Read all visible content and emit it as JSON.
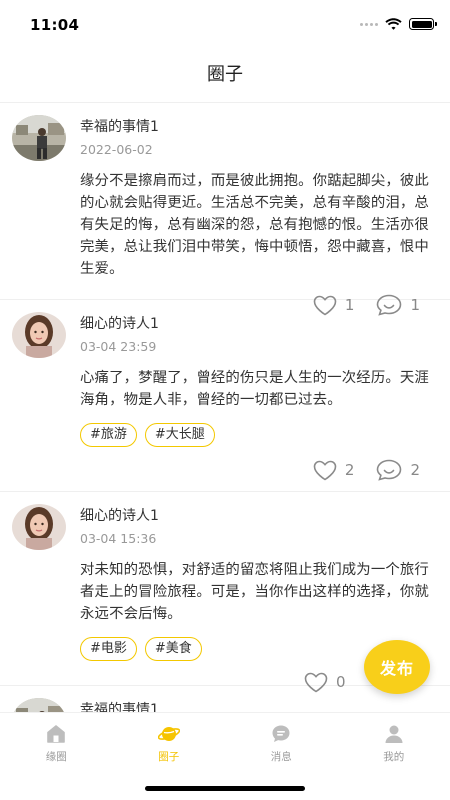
{
  "status_bar": {
    "time": "11:04"
  },
  "nav": {
    "title": "圈子"
  },
  "posts": [
    {
      "name": "幸福的事情1",
      "date": "2022-06-02",
      "text": "缘分不是擦肩而过，而是彼此拥抱。你踮起脚尖，彼此的心就会贴得更近。生活总不完美，总有辛酸的泪，总有失足的悔，总有幽深的怨，总有抱憾的恨。生活亦很完美，总让我们泪中带笑，悔中顿悟，怨中藏喜，恨中生爱。",
      "likes": "1",
      "comments": "1",
      "avatar_icon": "avatar-man-outdoor"
    },
    {
      "name": "细心的诗人1",
      "date": "03-04 23:59",
      "text": "心痛了，梦醒了，曾经的伤只是人生的一次经历。天涯海角，物是人非，曾经的一切都已过去。",
      "tags": [
        "#旅游",
        "#大长腿"
      ],
      "likes": "2",
      "comments": "2",
      "avatar_icon": "avatar-woman"
    },
    {
      "name": "细心的诗人1",
      "date": "03-04 15:36",
      "text": "对未知的恐惧，对舒适的留恋将阻止我们成为一个旅行者走上的冒险旅程。可是，当你作出这样的选择，你就永远不会后悔。",
      "tags": [
        "#电影",
        "#美食"
      ],
      "likes": "0",
      "avatar_icon": "avatar-woman"
    },
    {
      "name": "幸福的事情1",
      "avatar_icon": "avatar-man-outdoor"
    }
  ],
  "fab": {
    "label": "发布"
  },
  "tabs": [
    {
      "label": "缘圈",
      "icon": "home-icon",
      "active": false
    },
    {
      "label": "圈子",
      "icon": "planet-icon",
      "active": true
    },
    {
      "label": "消息",
      "icon": "message-icon",
      "active": false
    },
    {
      "label": "我的",
      "icon": "profile-icon",
      "active": false
    }
  ],
  "colors": {
    "accent": "#f8cf1a",
    "tag_border": "#f3c800",
    "inactive": "#9a9a9a"
  }
}
